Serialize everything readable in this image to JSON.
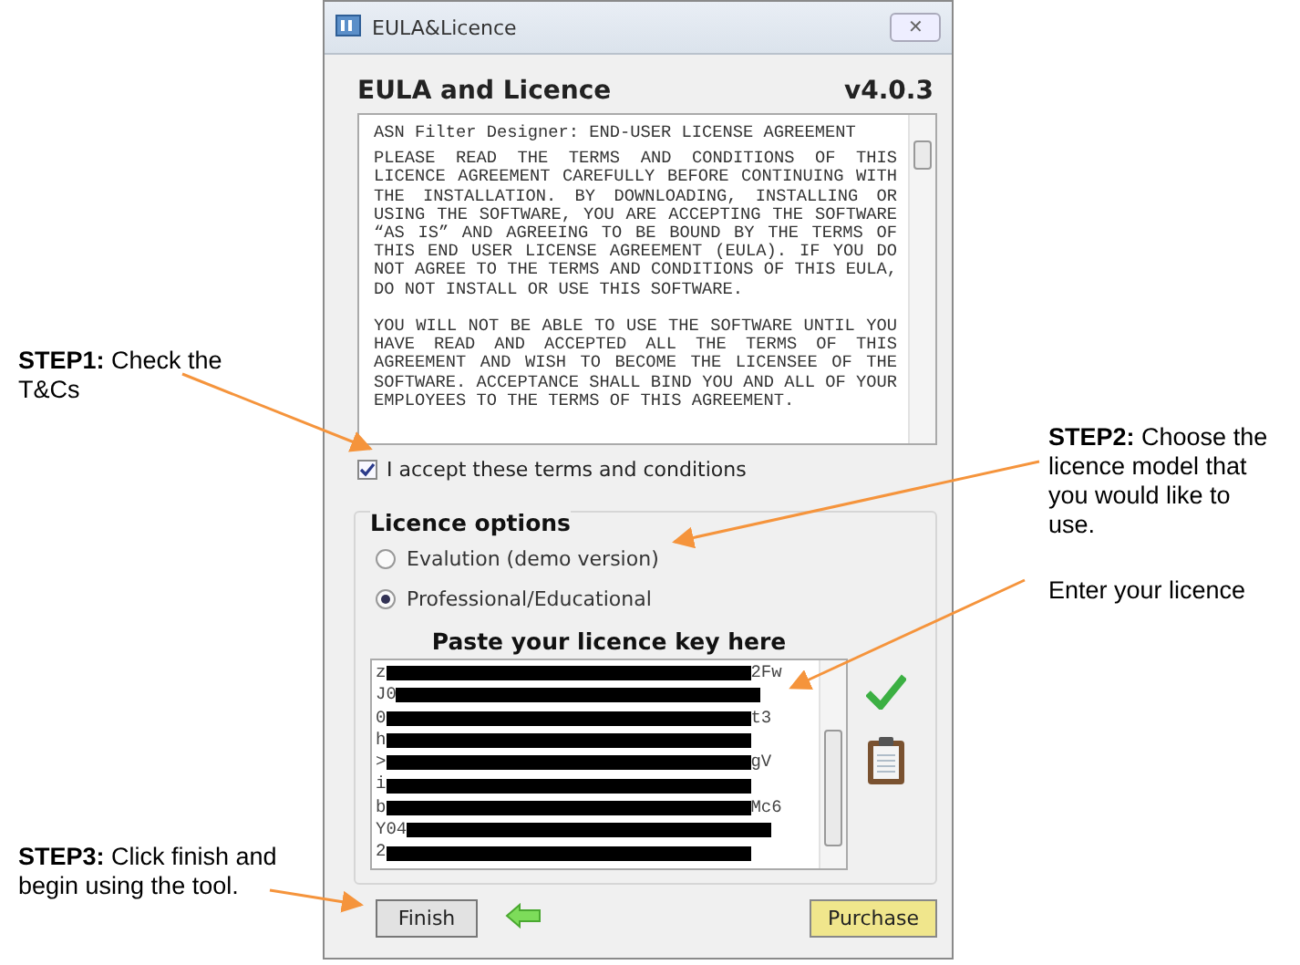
{
  "window": {
    "title": "EULA&Licence",
    "close": "✕"
  },
  "header": {
    "title": "EULA and Licence",
    "version": "v4.0.3"
  },
  "eula": {
    "heading": "ASN Filter Designer: END-USER LICENSE AGREEMENT",
    "paragraphs": [
      "PLEASE READ THE TERMS AND CONDITIONS OF THIS LICENCE AGREEMENT CAREFULLY BEFORE CONTINUING WITH THE INSTALLATION. BY DOWNLOADING, INSTALLING OR USING THE SOFTWARE, YOU ARE ACCEPTING THE SOFTWARE “AS IS” AND AGREEING TO BE BOUND BY THE TERMS OF THIS END USER LICENSE AGREEMENT (EULA). IF YOU DO NOT AGREE TO THE TERMS AND CONDITIONS OF THIS EULA, DO NOT INSTALL OR USE THIS SOFTWARE.",
      "YOU WILL NOT BE ABLE TO USE THE SOFTWARE UNTIL YOU HAVE READ AND ACCEPTED ALL THE TERMS OF THIS AGREEMENT AND WISH TO BECOME THE LICENSEE OF THE SOFTWARE. ACCEPTANCE SHALL BIND YOU AND ALL OF YOUR EMPLOYEES TO THE TERMS OF THIS AGREEMENT."
    ]
  },
  "accept": {
    "label": "I accept these terms and conditions",
    "checked": true
  },
  "licence_options": {
    "title": "Licence options",
    "options": [
      {
        "label": "Evalution (demo version)",
        "selected": false
      },
      {
        "label": "Professional/Educational",
        "selected": true
      }
    ]
  },
  "licence_key": {
    "title": "Paste your licence key here",
    "lines": [
      {
        "start": "z",
        "end": "2Fw"
      },
      {
        "start": "J0"
      },
      {
        "start": "0",
        "end": "t3"
      },
      {
        "start": "h"
      },
      {
        "start": ">",
        "end": "gV"
      },
      {
        "start": "i"
      },
      {
        "start": "b",
        "end": "Mc6"
      },
      {
        "start": "Y04"
      },
      {
        "start": "2"
      }
    ],
    "valid": true
  },
  "buttons": {
    "finish": "Finish",
    "purchase": "Purchase"
  },
  "annotations_left": [
    {
      "step": "STEP1:",
      "text": "Check the T&Cs"
    },
    {
      "step": "STEP3:",
      "text": "Click finish and begin using the tool."
    }
  ],
  "annotations_right": [
    {
      "step": "STEP2:",
      "text": "Choose the licence model that you would like to use."
    },
    {
      "text": "Enter your licence"
    }
  ]
}
